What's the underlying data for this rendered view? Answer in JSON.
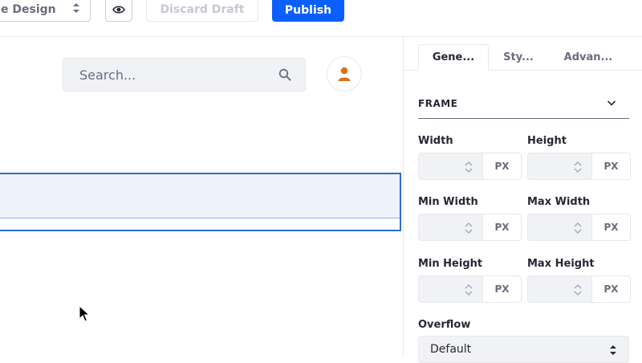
{
  "toolbar": {
    "design_select_label": "e Design",
    "discard_label": "Discard Draft",
    "publish_label": "Publish"
  },
  "canvas": {
    "search_placeholder": "Search..."
  },
  "panel": {
    "tabs": [
      {
        "label": "Gene..."
      },
      {
        "label": "Sty..."
      },
      {
        "label": "Advan..."
      }
    ],
    "section_title": "FRAME",
    "fields": {
      "width": {
        "label": "Width",
        "unit": "PX",
        "value": ""
      },
      "height": {
        "label": "Height",
        "unit": "PX",
        "value": ""
      },
      "min_width": {
        "label": "Min Width",
        "unit": "PX",
        "value": ""
      },
      "max_width": {
        "label": "Max Width",
        "unit": "PX",
        "value": ""
      },
      "min_height": {
        "label": "Min Height",
        "unit": "PX",
        "value": ""
      },
      "max_height": {
        "label": "Max Height",
        "unit": "PX",
        "value": ""
      }
    },
    "overflow": {
      "label": "Overflow",
      "value": "Default"
    }
  },
  "icons": {
    "preview": "eye-icon",
    "search": "search-icon",
    "avatar": "user-icon",
    "section_toggle": "chevron-down-icon",
    "selects": "caret-double-icon",
    "cursor": "mouse-pointer-icon"
  },
  "colors": {
    "primary": "#0b5fff",
    "selection_border": "#2e6bd1",
    "avatar_user": "#d9731a"
  }
}
